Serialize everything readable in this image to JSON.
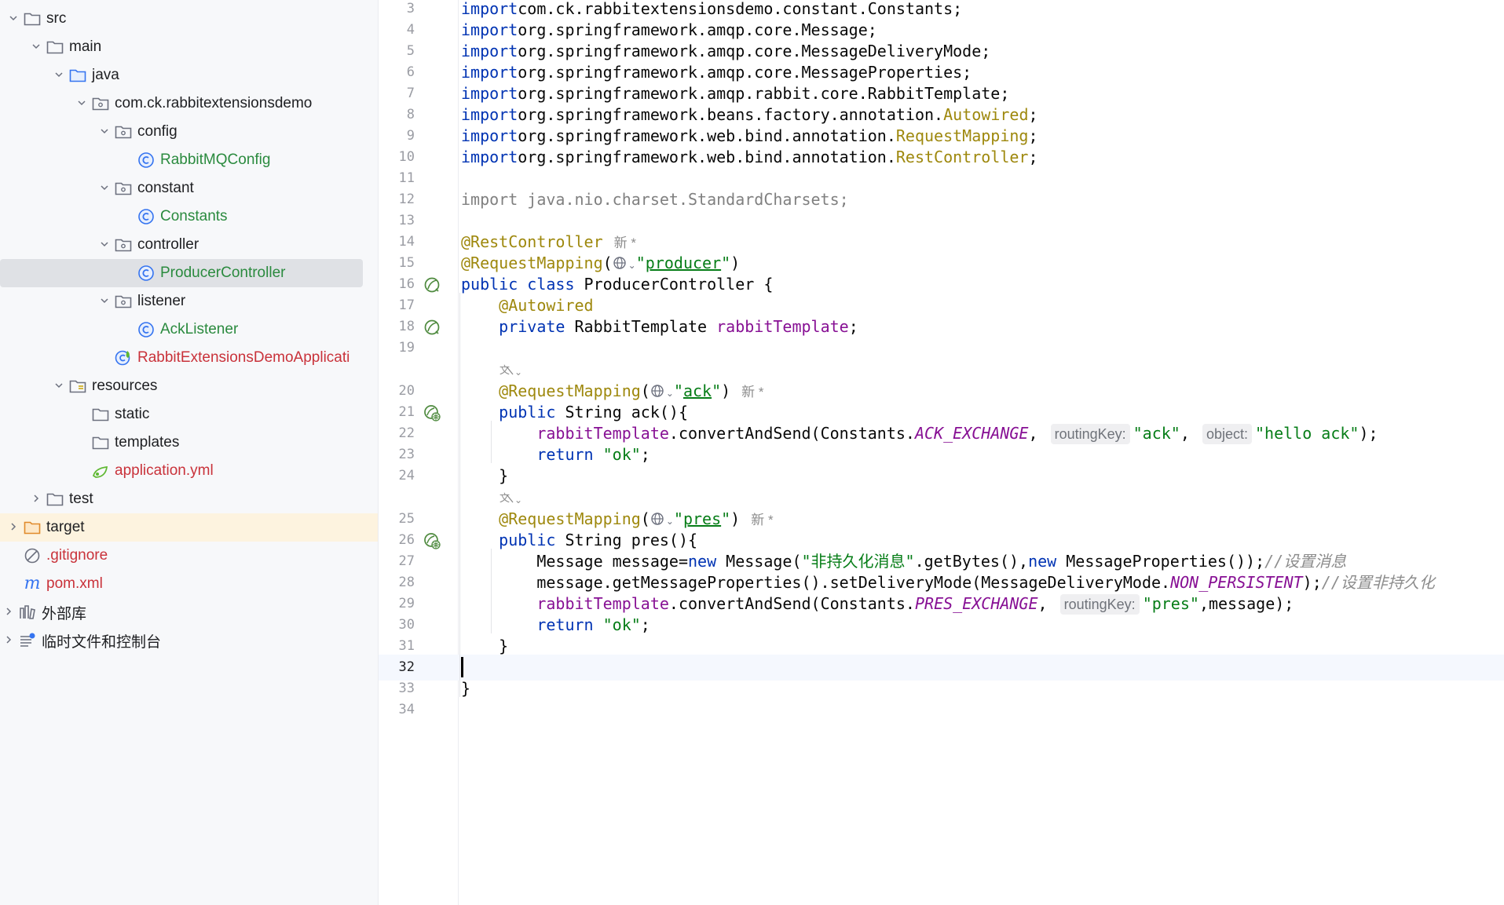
{
  "tree": {
    "items": [
      {
        "label": "src",
        "icon": "folder-icon",
        "indent": 0,
        "chevron": "down"
      },
      {
        "label": "main",
        "icon": "folder-icon",
        "indent": 1,
        "chevron": "down"
      },
      {
        "label": "java",
        "icon": "source-folder-icon",
        "indent": 2,
        "chevron": "down"
      },
      {
        "label": "com.ck.rabbitextensionsdemo",
        "icon": "package-icon",
        "indent": 3,
        "chevron": "down"
      },
      {
        "label": "config",
        "icon": "package-icon",
        "indent": 4,
        "chevron": "down"
      },
      {
        "label": "RabbitMQConfig",
        "icon": "class-icon",
        "indent": 5,
        "chevron": "",
        "color": "green"
      },
      {
        "label": "constant",
        "icon": "package-icon",
        "indent": 4,
        "chevron": "down"
      },
      {
        "label": "Constants",
        "icon": "class-icon",
        "indent": 5,
        "chevron": "",
        "color": "green"
      },
      {
        "label": "controller",
        "icon": "package-icon",
        "indent": 4,
        "chevron": "down"
      },
      {
        "label": "ProducerController",
        "icon": "class-icon",
        "indent": 5,
        "chevron": "",
        "color": "green",
        "selected": true
      },
      {
        "label": "listener",
        "icon": "package-icon",
        "indent": 4,
        "chevron": "down"
      },
      {
        "label": "AckListener",
        "icon": "class-icon",
        "indent": 5,
        "chevron": "",
        "color": "green"
      },
      {
        "label": "RabbitExtensionsDemoApplicati",
        "icon": "spring-boot-class-icon",
        "indent": 5,
        "chevron": "",
        "color": "red",
        "shift": -1
      },
      {
        "label": "resources",
        "icon": "resources-folder-icon",
        "indent": 2,
        "chevron": "down"
      },
      {
        "label": "static",
        "icon": "folder-icon",
        "indent": 3,
        "chevron": ""
      },
      {
        "label": "templates",
        "icon": "folder-icon",
        "indent": 3,
        "chevron": ""
      },
      {
        "label": "application.yml",
        "icon": "spring-config-icon",
        "indent": 3,
        "chevron": "",
        "color": "red"
      },
      {
        "label": "test",
        "icon": "folder-icon",
        "indent": 1,
        "chevron": "right"
      },
      {
        "label": "target",
        "icon": "excluded-folder-icon",
        "indent": 0,
        "chevron": "right",
        "excluded": true
      },
      {
        "label": ".gitignore",
        "icon": "ignore-file-icon",
        "indent": 0,
        "chevron": "",
        "color": "red"
      },
      {
        "label": "pom.xml",
        "icon": "maven-icon",
        "indent": 0,
        "chevron": "",
        "color": "red"
      },
      {
        "label": "外部库",
        "icon": "libraries-icon",
        "indent": -1,
        "chevron": "right"
      },
      {
        "label": "临时文件和控制台",
        "icon": "scratches-icon",
        "indent": -1,
        "chevron": "right"
      }
    ]
  },
  "editor": {
    "current_line": "32",
    "lines": [
      {
        "n": "3",
        "tokens": [
          [
            "kw",
            "import"
          ],
          [
            "",
            "com.ck.rabbitextensionsdemo.constant.Constants;"
          ]
        ]
      },
      {
        "n": "4",
        "tokens": [
          [
            "kw",
            "import"
          ],
          [
            "",
            "org.springframework.amqp.core.Message;"
          ]
        ]
      },
      {
        "n": "5",
        "tokens": [
          [
            "kw",
            "import"
          ],
          [
            "",
            "org.springframework.amqp.core.MessageDeliveryMode;"
          ]
        ]
      },
      {
        "n": "6",
        "tokens": [
          [
            "kw",
            "import"
          ],
          [
            "",
            "org.springframework.amqp.core.MessageProperties;"
          ]
        ]
      },
      {
        "n": "7",
        "tokens": [
          [
            "kw",
            "import"
          ],
          [
            "",
            "org.springframework.amqp.rabbit.core.RabbitTemplate;"
          ]
        ]
      },
      {
        "n": "8",
        "tokens": [
          [
            "kw",
            "import"
          ],
          [
            "",
            "org.springframework.beans.factory.annotation."
          ],
          [
            "ann",
            "Autowired"
          ],
          [
            "",
            ";"
          ]
        ]
      },
      {
        "n": "9",
        "tokens": [
          [
            "kw",
            "import"
          ],
          [
            "",
            "org.springframework.web.bind.annotation."
          ],
          [
            "ann",
            "RequestMapping"
          ],
          [
            "",
            ";"
          ]
        ]
      },
      {
        "n": "10",
        "tokens": [
          [
            "kw",
            "import"
          ],
          [
            "",
            "org.springframework.web.bind.annotation."
          ],
          [
            "ann",
            "RestController"
          ],
          [
            "",
            ";"
          ]
        ]
      },
      {
        "n": "11",
        "tokens": []
      },
      {
        "n": "12",
        "tokens": [
          [
            "gray",
            "import java.nio.charset.StandardCharsets;"
          ]
        ]
      },
      {
        "n": "13",
        "tokens": []
      },
      {
        "n": "14",
        "tokens": [
          [
            "ann",
            "@RestController"
          ],
          [
            "author",
            "新 *"
          ]
        ]
      },
      {
        "n": "15",
        "tokens": [
          [
            "ann",
            "@RequestMapping"
          ],
          [
            "",
            "("
          ],
          [
            "globe",
            ""
          ],
          [
            "str",
            "\""
          ],
          [
            "strul",
            "producer"
          ],
          [
            "str",
            "\""
          ],
          [
            "",
            ")"
          ]
        ]
      },
      {
        "n": "16",
        "gutter": "bean-icon",
        "tokens": [
          [
            "kw",
            "public class"
          ],
          [
            "",
            " ProducerController {"
          ]
        ]
      },
      {
        "n": "17",
        "tokens": [
          [
            "",
            "    "
          ],
          [
            "ann",
            "@Autowired"
          ]
        ]
      },
      {
        "n": "18",
        "gutter": "bean-icon",
        "tokens": [
          [
            "",
            "    "
          ],
          [
            "kw",
            "private"
          ],
          [
            "",
            " RabbitTemplate "
          ],
          [
            "fld",
            "rabbitTemplate"
          ],
          [
            "",
            ";"
          ]
        ]
      },
      {
        "n": "19",
        "tokens": []
      },
      {
        "n": "20",
        "lens_before": true,
        "tokens": [
          [
            "",
            "    "
          ],
          [
            "ann",
            "@RequestMapping"
          ],
          [
            "",
            "("
          ],
          [
            "globe",
            ""
          ],
          [
            "str",
            "\""
          ],
          [
            "strul",
            "ack"
          ],
          [
            "str",
            "\""
          ],
          [
            "",
            ")"
          ],
          [
            "author",
            "新 *"
          ]
        ]
      },
      {
        "n": "21",
        "gutter": "endpoint-icon",
        "tokens": [
          [
            "",
            "    "
          ],
          [
            "kw",
            "public"
          ],
          [
            "",
            " String ack(){"
          ]
        ]
      },
      {
        "n": "22",
        "tokens": [
          [
            "",
            "        "
          ],
          [
            "fld",
            "rabbitTemplate"
          ],
          [
            "",
            ".convertAndSend(Constants."
          ],
          [
            "fldi",
            "ACK_EXCHANGE"
          ],
          [
            "",
            ", "
          ],
          [
            "hint",
            "routingKey:"
          ],
          [
            "str",
            "\"ack\""
          ],
          [
            "",
            ", "
          ],
          [
            "hint",
            "object:"
          ],
          [
            "str",
            "\"hello ack\""
          ],
          [
            "",
            ");"
          ]
        ]
      },
      {
        "n": "23",
        "tokens": [
          [
            "",
            "        "
          ],
          [
            "kw",
            "return"
          ],
          [
            "",
            " "
          ],
          [
            "str",
            "\"ok\""
          ],
          [
            "",
            ";"
          ]
        ]
      },
      {
        "n": "24",
        "tokens": [
          [
            "",
            "    }"
          ]
        ]
      },
      {
        "n": "25",
        "lens_before": true,
        "tokens": [
          [
            "",
            "    "
          ],
          [
            "ann",
            "@RequestMapping"
          ],
          [
            "",
            "("
          ],
          [
            "globe",
            ""
          ],
          [
            "str",
            "\""
          ],
          [
            "strul",
            "pres"
          ],
          [
            "str",
            "\""
          ],
          [
            "",
            ")"
          ],
          [
            "author",
            "新 *"
          ]
        ]
      },
      {
        "n": "26",
        "gutter": "endpoint-icon",
        "tokens": [
          [
            "",
            "    "
          ],
          [
            "kw",
            "public"
          ],
          [
            "",
            " String pres(){"
          ]
        ]
      },
      {
        "n": "27",
        "tokens": [
          [
            "",
            "        Message message="
          ],
          [
            "kw",
            "new"
          ],
          [
            "",
            " Message("
          ],
          [
            "str",
            "\"非持久化消息\""
          ],
          [
            "",
            ".getBytes(),"
          ],
          [
            "kw",
            "new"
          ],
          [
            "",
            " MessageProperties());"
          ],
          [
            "cmt",
            "//设置消息"
          ]
        ]
      },
      {
        "n": "28",
        "tokens": [
          [
            "",
            "        message.getMessageProperties().setDeliveryMode(MessageDeliveryMode."
          ],
          [
            "fldi",
            "NON_PERSISTENT"
          ],
          [
            "",
            ");"
          ],
          [
            "cmt",
            "//设置非持久化"
          ]
        ]
      },
      {
        "n": "29",
        "tokens": [
          [
            "",
            "        "
          ],
          [
            "fld",
            "rabbitTemplate"
          ],
          [
            "",
            ".convertAndSend(Constants."
          ],
          [
            "fldi",
            "PRES_EXCHANGE"
          ],
          [
            "",
            ", "
          ],
          [
            "hint",
            "routingKey:"
          ],
          [
            "str",
            "\"pres\""
          ],
          [
            "",
            ",message);"
          ]
        ]
      },
      {
        "n": "30",
        "tokens": [
          [
            "",
            "        "
          ],
          [
            "kw",
            "return"
          ],
          [
            "",
            " "
          ],
          [
            "str",
            "\"ok\""
          ],
          [
            "",
            ";"
          ]
        ]
      },
      {
        "n": "31",
        "tokens": [
          [
            "",
            "    }"
          ]
        ]
      },
      {
        "n": "32",
        "tokens": [
          [
            "cursor",
            ""
          ]
        ]
      },
      {
        "n": "33",
        "tokens": [
          [
            "",
            "}"
          ]
        ]
      },
      {
        "n": "34",
        "tokens": []
      }
    ],
    "lens_icon": "translate-icon"
  }
}
